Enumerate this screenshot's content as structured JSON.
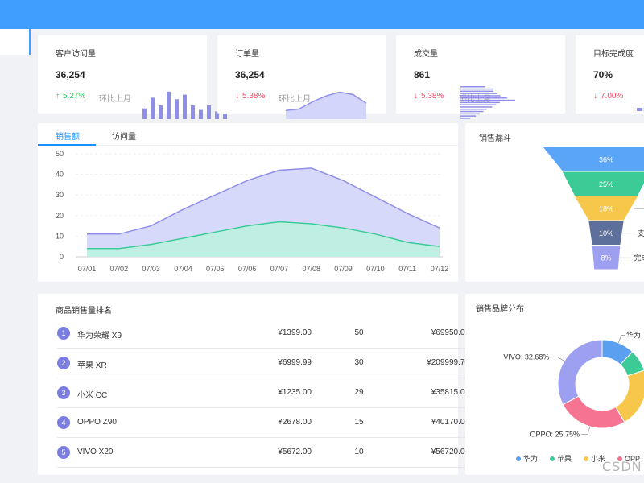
{
  "kpis": [
    {
      "title": "客户访问量",
      "value": "36,254",
      "direction": "up",
      "arrow": "↑",
      "change": "5.27%",
      "compare": "环比上月",
      "chart": "bar"
    },
    {
      "title": "订单量",
      "value": "36,254",
      "direction": "down",
      "arrow": "↓",
      "change": "5.38%",
      "compare": "环比上月",
      "chart": "area"
    },
    {
      "title": "成交量",
      "value": "861",
      "direction": "down",
      "arrow": "↓",
      "change": "5.38%",
      "compare": "环比上月",
      "chart": "hbar"
    },
    {
      "title": "目标完成度",
      "value": "70%",
      "direction": "down",
      "arrow": "↓",
      "change": "7.00%",
      "compare": "环比上月",
      "chart": "progress",
      "progress": 0.7
    }
  ],
  "sales_tabs": [
    "销售额",
    "访问量"
  ],
  "funnel_title": "销售漏斗",
  "funnel_side_labels": [
    "支付",
    "完成"
  ],
  "ranking_title": "商品销售量排名",
  "ranking_rows": [
    {
      "rank": "1",
      "name": "华为荣耀 X9",
      "price": "¥1399.00",
      "qty": "50",
      "total": "¥69950.00"
    },
    {
      "rank": "2",
      "name": "苹果 XR",
      "price": "¥6999.99",
      "qty": "30",
      "total": "¥209999.70"
    },
    {
      "rank": "3",
      "name": "小米 CC",
      "price": "¥1235.00",
      "qty": "29",
      "total": "¥35815.00"
    },
    {
      "rank": "4",
      "name": "OPPO Z90",
      "price": "¥2678.00",
      "qty": "15",
      "total": "¥40170.00"
    },
    {
      "rank": "5",
      "name": "VIVO X20",
      "price": "¥5672.00",
      "qty": "10",
      "total": "¥56720.00"
    }
  ],
  "brand_title": "销售品牌分布",
  "legend_labels": [
    "华为",
    "苹果",
    "小米",
    "OPP"
  ],
  "watermark": "CSDN",
  "colors": {
    "primary": "#409eff",
    "tab_active": "#1890ff",
    "up": "#2fc25b",
    "down": "#f04864",
    "purple": "#8f8fe8",
    "purple_fill": "#d3d5fa",
    "green": "#3ccb97",
    "green_fill": "#bdf0df"
  },
  "chart_data": [
    {
      "type": "bar",
      "ylim": [
        0,
        10
      ],
      "categories": [
        "1",
        "2",
        "3",
        "4",
        "5",
        "6",
        "7",
        "8",
        "9",
        "10",
        "11"
      ],
      "values": [
        3.5,
        7,
        4.5,
        9,
        6.5,
        8,
        4.5,
        3,
        4.5,
        2.5,
        6.5
      ]
    },
    {
      "type": "area",
      "ylim": [
        0,
        10
      ],
      "categories": [
        "1",
        "2",
        "3",
        "4",
        "5",
        "6",
        "7"
      ],
      "values": [
        3,
        3.5,
        6,
        8,
        9.3,
        8.5,
        5.5
      ]
    },
    {
      "type": "bar",
      "orientation": "horizontal",
      "xlim": [
        0,
        10
      ],
      "categories": [
        "1",
        "2",
        "3",
        "4",
        "5",
        "6",
        "7",
        "8",
        "9",
        "10",
        "11",
        "12",
        "13",
        "14",
        "15"
      ],
      "values": [
        4.5,
        6,
        6,
        6.7,
        7.3,
        8.5,
        10,
        7.2,
        6.5,
        5.8,
        4.8,
        4.2,
        3.5,
        2.8,
        1.8
      ]
    },
    {
      "type": "area",
      "title": "",
      "x": [
        "07/01",
        "07/02",
        "07/03",
        "07/04",
        "07/05",
        "07/06",
        "07/07",
        "07/08",
        "07/09",
        "07/10",
        "07/11",
        "07/12"
      ],
      "ylim": [
        0,
        50
      ],
      "yticks": [
        0,
        10,
        20,
        30,
        40,
        50
      ],
      "grid": true,
      "series": [
        {
          "color": "#8f8fe8",
          "fill": "#d3d5fa",
          "values": [
            11,
            11,
            15,
            23,
            30,
            37,
            42,
            43,
            37,
            29,
            21,
            14
          ]
        },
        {
          "color": "#3ccb97",
          "fill": "#bdf0df",
          "values": [
            4,
            4,
            6,
            9,
            12,
            15,
            17,
            16,
            14,
            11,
            7,
            5
          ]
        }
      ]
    },
    {
      "type": "funnel",
      "categories": [
        "",
        "",
        "",
        "支付",
        "完成"
      ],
      "values": [
        36,
        25,
        18,
        10,
        8
      ],
      "labels": [
        "36%",
        "25%",
        "18%",
        "10%",
        "8%"
      ],
      "colors": [
        "#5aa5f7",
        "#3ccb97",
        "#f6c74a",
        "#5d6f9b",
        "#9da0f0"
      ]
    },
    {
      "type": "pie",
      "series": [
        {
          "name": "华为",
          "value": 12,
          "color": "#5b9ff1"
        },
        {
          "name": "苹果",
          "value": 8,
          "color": "#3ccb97"
        },
        {
          "name": "小米",
          "value": 21.57,
          "color": "#f6c74a"
        },
        {
          "name": "OPPO",
          "value": 25.75,
          "color": "#f67391"
        },
        {
          "name": "VIVO",
          "value": 32.68,
          "color": "#9da0f0"
        }
      ],
      "labels": [
        {
          "text": "华为",
          "side": "right"
        },
        {
          "text": "VIVO: 32.68%",
          "side": "left"
        },
        {
          "text": "OPPO: 25.75%",
          "side": "left"
        }
      ]
    }
  ]
}
